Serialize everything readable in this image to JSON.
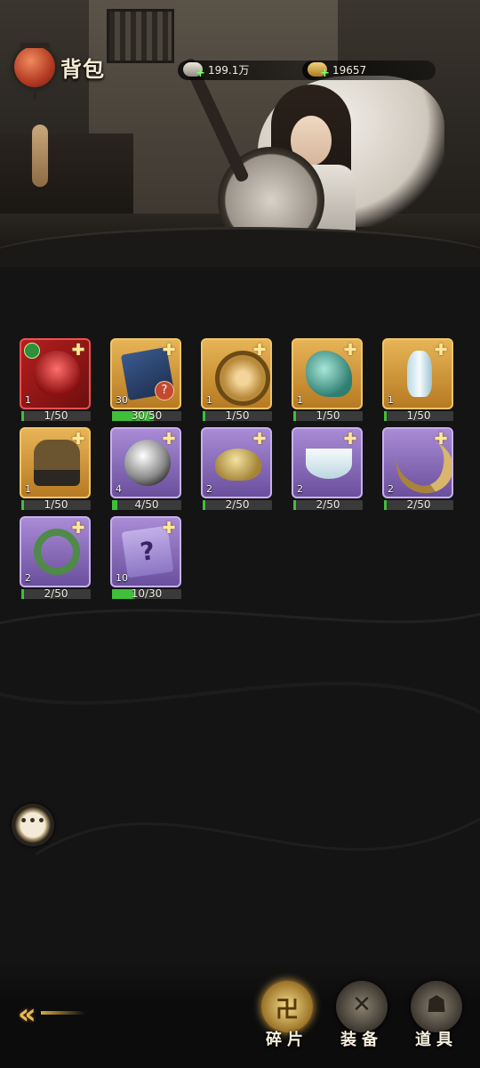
{
  "header": {
    "title": "背包",
    "resources": {
      "silver": "199.1万",
      "gold": "19657"
    }
  },
  "items": [
    {
      "rarity": "red",
      "icon": "warrior-fragment-icon",
      "count": "1",
      "progress": "1/50",
      "fraction": 0.02,
      "badge": true,
      "frag": true
    },
    {
      "rarity": "gold",
      "icon": "card-fragment-icon",
      "count": "30",
      "progress": "30/50",
      "fraction": 0.6,
      "question": "?",
      "frag": true
    },
    {
      "rarity": "gold",
      "icon": "fan-fragment-icon",
      "count": "1",
      "progress": "1/50",
      "fraction": 0.02,
      "frag": true
    },
    {
      "rarity": "gold",
      "icon": "jade-fragment-icon",
      "count": "1",
      "progress": "1/50",
      "fraction": 0.02,
      "frag": true
    },
    {
      "rarity": "gold",
      "icon": "vase-fragment-icon",
      "count": "1",
      "progress": "1/50",
      "fraction": 0.02,
      "frag": true
    },
    {
      "rarity": "gold",
      "icon": "bonsai-fragment-icon",
      "count": "1",
      "progress": "1/50",
      "fraction": 0.02,
      "frag": true
    },
    {
      "rarity": "purple",
      "icon": "jar-fragment-icon",
      "count": "4",
      "progress": "4/50",
      "fraction": 0.08,
      "frag": true
    },
    {
      "rarity": "purple",
      "icon": "gold-ingot-fragment-icon",
      "count": "2",
      "progress": "2/50",
      "fraction": 0.04,
      "frag": true
    },
    {
      "rarity": "purple",
      "icon": "teacup-fragment-icon",
      "count": "2",
      "progress": "2/50",
      "fraction": 0.04,
      "frag": true
    },
    {
      "rarity": "purple",
      "icon": "horn-fragment-icon",
      "count": "2",
      "progress": "2/50",
      "fraction": 0.04,
      "frag": true
    },
    {
      "rarity": "purple",
      "icon": "ring-fragment-icon",
      "count": "2",
      "progress": "2/50",
      "fraction": 0.04,
      "frag": true
    },
    {
      "rarity": "purple",
      "icon": "scroll-fragment-icon",
      "count": "10",
      "progress": "10/30",
      "fraction": 0.333,
      "scroll_mark": "?",
      "frag": true
    }
  ],
  "chat": {
    "dots": "•••"
  },
  "tabs": [
    {
      "label": "碎片",
      "glyph": "卍",
      "active": true
    },
    {
      "label": "装备",
      "glyph": "✕",
      "active": false
    },
    {
      "label": "道具",
      "glyph": "☗",
      "active": false
    }
  ],
  "colors": {
    "red_card": "#b51e1e",
    "gold_card": "#e7b456",
    "purple_card": "#a98bd6",
    "progress_fill": "#3fbf3a",
    "accent_gold": "#e7b85c"
  }
}
